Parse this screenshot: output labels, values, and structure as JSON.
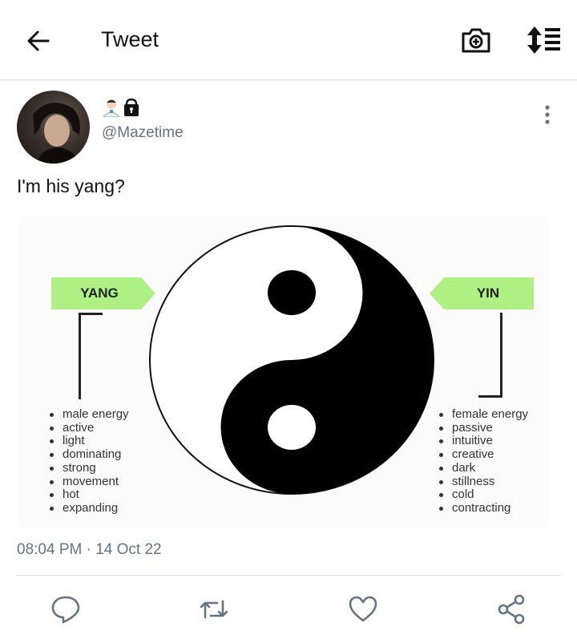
{
  "header": {
    "title": "Tweet",
    "back_icon": "arrow-left-icon",
    "camera_icon": "camera-plus-icon",
    "sort_icon": "sort-list-icon"
  },
  "tweet": {
    "handle": "@Mazetime",
    "emojis": [
      "health-worker-emoji",
      "locked-bag-emoji"
    ],
    "text": "I'm his yang?",
    "timestamp": "08:04 PM · 14 Oct 22"
  },
  "image": {
    "yang_label": "YANG",
    "yin_label": "YIN",
    "tag_color": "#aef084",
    "yang_traits": [
      "male energy",
      "active",
      "light",
      "dominating",
      "strong",
      "movement",
      "hot",
      "expanding"
    ],
    "yin_traits": [
      "female energy",
      "passive",
      "intuitive",
      "creative",
      "dark",
      "stillness",
      "cold",
      "contracting"
    ]
  },
  "actions": [
    "reply-icon",
    "retweet-icon",
    "like-icon",
    "share-icon"
  ]
}
